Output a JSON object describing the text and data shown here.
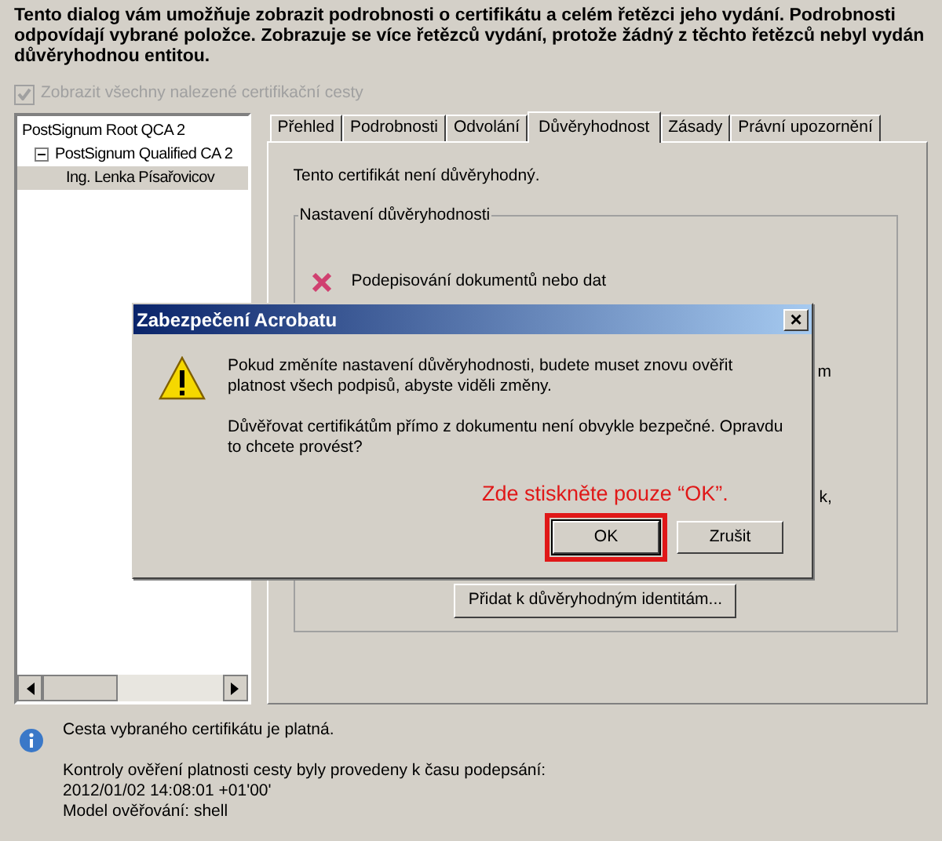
{
  "intro": "Tento dialog vám umožňuje zobrazit podrobnosti o certifikátu a celém řetězci jeho vydání. Podrobnosti odpovídají vybrané položce. Zobrazuje se více řetězců vydání, protože žádný z těchto řetězců nebyl vydán důvěryhodnou entitou.",
  "show_all_paths": {
    "label": "Zobrazit všechny nalezené certifikační cesty",
    "checked": true,
    "disabled": true
  },
  "tree": [
    {
      "label": "PostSignum Root QCA 2",
      "selected": false,
      "children": [
        {
          "label": "PostSignum Qualified CA 2",
          "selected": false,
          "expanded": true,
          "children": [
            {
              "label": "Ing. Lenka Písařovicov",
              "selected": true
            }
          ]
        }
      ]
    }
  ],
  "tabs": [
    {
      "label": "Přehled",
      "selected": false
    },
    {
      "label": "Podrobnosti",
      "selected": false
    },
    {
      "label": "Odvolání",
      "selected": false
    },
    {
      "label": "Důvěryhodnost",
      "selected": true
    },
    {
      "label": "Zásady",
      "selected": false
    },
    {
      "label": "Právní upozornění",
      "selected": false
    }
  ],
  "trust": {
    "status": "Tento certifikát není důvěryhodný.",
    "group_title": "Nastavení důvěryhodnosti",
    "items": [
      {
        "label": "Podepisování dokumentů nebo dat",
        "allowed": false
      }
    ],
    "hidden_fragments": [
      "m",
      "k,"
    ],
    "add_button": "Přidat k důvěryhodným identitám..."
  },
  "dialog": {
    "title": "Zabezpečení Acrobatu",
    "close": "×",
    "message": [
      "Pokud změníte nastavení důvěryhodnosti, budete muset znovu ověřit platnost všech podpisů, abyste viděli změny.",
      "Důvěřovat certifikátům přímo z dokumentu není obvykle bezpečné. Opravdu to chcete provést?"
    ],
    "annotation": "Zde stiskněte pouze “OK”.",
    "buttons": [
      {
        "label": "OK",
        "highlighted": true
      },
      {
        "label": "Zrušit",
        "highlighted": false
      }
    ]
  },
  "status": {
    "summary": "Cesta vybraného certifikátu je platná.",
    "details": [
      "Kontroly ověření platnosti cesty byly provedeny k času podepsání:",
      "2012/01/02 14:08:01 +01'00'",
      "Model ověřování: shell"
    ]
  }
}
